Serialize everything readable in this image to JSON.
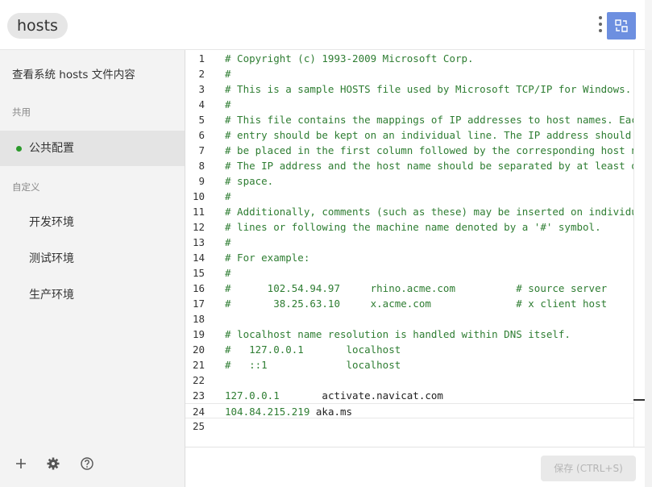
{
  "window": {
    "title": "hosts",
    "menu_icon": "kebab-menu-icon",
    "toggle_icon": "swap-view-icon",
    "accent": "#6d8fe0"
  },
  "sidebar": {
    "heading": "查看系统 hosts 文件内容",
    "groups": [
      {
        "label": "共用",
        "items": [
          {
            "label": "公共配置",
            "active": true,
            "status_color": "#2c9a2c"
          }
        ]
      },
      {
        "label": "自定义",
        "items": [
          {
            "label": "开发环境"
          },
          {
            "label": "测试环境"
          },
          {
            "label": "生产环境"
          }
        ]
      }
    ],
    "bottom_icons": [
      "plus-icon",
      "gear-icon",
      "help-icon"
    ]
  },
  "editor": {
    "lines": [
      "# Copyright (c) 1993-2009 Microsoft Corp.",
      "#",
      "# This is a sample HOSTS file used by Microsoft TCP/IP for Windows.",
      "#",
      "# This file contains the mappings of IP addresses to host names. Eac",
      "# entry should be kept on an individual line. The IP address should",
      "# be placed in the first column followed by the corresponding host n",
      "# The IP address and the host name should be separated by at least o",
      "# space.",
      "#",
      "# Additionally, comments (such as these) may be inserted on individu",
      "# lines or following the machine name denoted by a '#' symbol.",
      "#",
      "# For example:",
      "#",
      "#      102.54.94.97     rhino.acme.com          # source server",
      "#       38.25.63.10     x.acme.com              # x client host",
      "",
      "# localhost name resolution is handled within DNS itself.",
      "#   127.0.0.1       localhost",
      "#   ::1             localhost",
      "",
      {
        "ip": "127.0.0.1",
        "gap": "       ",
        "host": "activate.navicat.com"
      },
      {
        "ip": "104.84.215.219",
        "gap": " ",
        "host": "aka.ms"
      },
      ""
    ]
  },
  "footer": {
    "save_label": "保存 (CTRL+S)"
  }
}
